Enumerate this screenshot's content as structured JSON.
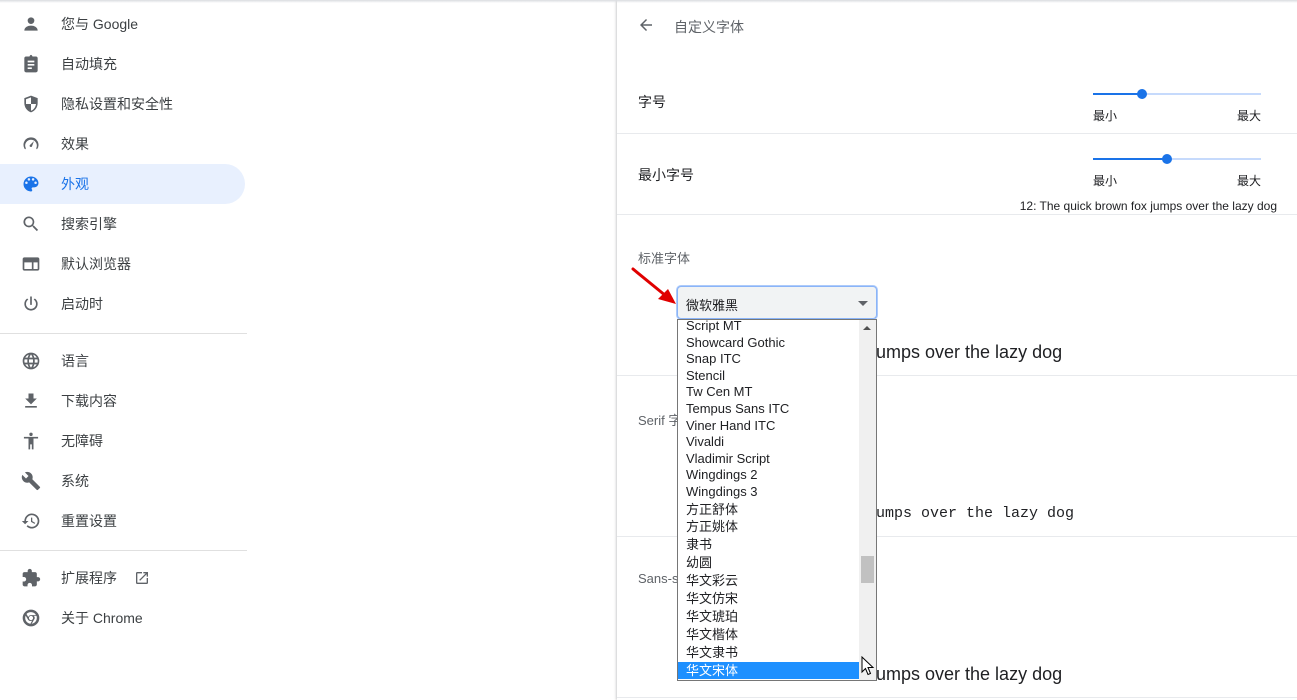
{
  "sidebar": {
    "items": [
      {
        "label": "您与 Google",
        "icon": "person-icon"
      },
      {
        "label": "自动填充",
        "icon": "clipboard-icon"
      },
      {
        "label": "隐私设置和安全性",
        "icon": "shield-icon"
      },
      {
        "label": "效果",
        "icon": "speedometer-icon"
      },
      {
        "label": "外观",
        "icon": "palette-icon",
        "active": true
      },
      {
        "label": "搜索引擎",
        "icon": "search-icon"
      },
      {
        "label": "默认浏览器",
        "icon": "browser-icon"
      },
      {
        "label": "启动时",
        "icon": "power-icon"
      },
      {
        "label": "语言",
        "icon": "globe-icon"
      },
      {
        "label": "下载内容",
        "icon": "download-icon"
      },
      {
        "label": "无障碍",
        "icon": "accessibility-icon"
      },
      {
        "label": "系统",
        "icon": "wrench-icon"
      },
      {
        "label": "重置设置",
        "icon": "history-icon"
      },
      {
        "label": "扩展程序",
        "icon": "puzzle-icon",
        "external": "open-in-new-icon"
      },
      {
        "label": "关于 Chrome",
        "icon": "chrome-icon"
      }
    ]
  },
  "header": {
    "back_icon": "arrow-back-icon",
    "title": "自定义字体"
  },
  "font_size": {
    "label": "字号",
    "min_label": "最小",
    "max_label": "最大",
    "value_fraction": 0.29
  },
  "min_font_size": {
    "label": "最小字号",
    "min_label": "最小",
    "max_label": "最大",
    "value_fraction": 0.44,
    "sample": "12: The quick brown fox jumps over the lazy dog"
  },
  "standard_font": {
    "label": "标准字体",
    "selected": "微软雅黑",
    "sample_visible": "umps over the lazy dog"
  },
  "serif_font": {
    "label_visible": "Serif 字",
    "sample_visible": "umps over the lazy dog"
  },
  "sans_serif_font": {
    "label_visible": "Sans-s",
    "sample_visible": "umps over the lazy dog"
  },
  "dropdown": {
    "options": [
      "Script MT",
      "Showcard Gothic",
      "Snap ITC",
      "Stencil",
      "Tw Cen MT",
      "Tempus Sans ITC",
      "Viner Hand ITC",
      "Vivaldi",
      "Vladimir Script",
      "Wingdings 2",
      "Wingdings 3",
      "方正舒体",
      "方正姚体",
      "隶书",
      "幼圆",
      "华文彩云",
      "华文仿宋",
      "华文琥珀",
      "华文楷体",
      "华文隶书",
      "华文宋体"
    ],
    "highlighted": "华文宋体"
  },
  "colors": {
    "accent": "#1a73e8",
    "active_bg": "#e8f0fe",
    "highlight": "#1e90ff",
    "annotation_arrow": "#e00000"
  }
}
